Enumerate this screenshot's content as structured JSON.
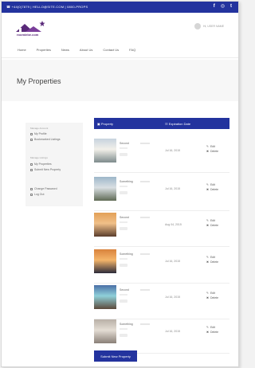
{
  "topbar": {
    "contact": "☎ +44(0)7879 | HELLO@SITE.COM | 0800-PROPS",
    "social": [
      "f",
      "◎",
      "t"
    ]
  },
  "brand": {
    "name": "roomiebe.com"
  },
  "user": {
    "name": "Hi, USER NAME"
  },
  "nav": {
    "items": [
      "Home",
      "Properties",
      "News",
      "About Us",
      "Contact Us",
      "FAQ"
    ]
  },
  "page": {
    "title": "My Properties"
  },
  "sidebar": {
    "groups": [
      {
        "heading": "Manage Account",
        "links": [
          "My Profile",
          "Bookmarked Listings"
        ]
      },
      {
        "heading": "Manage Listings",
        "links": [
          "My Properties",
          "Submit New Property"
        ]
      },
      {
        "heading": "",
        "links": [
          "Change Password",
          "Log Out"
        ]
      }
    ]
  },
  "table": {
    "col_property": "▣ Property",
    "col_expiration": "☷ Expiration Date",
    "edit_label": "Edit",
    "delete_label": "Delete",
    "rows": [
      {
        "name": "Second",
        "date": "Jul 16, 2015",
        "colors": [
          "#c7d3de",
          "#7d8b8c",
          "#f2f0ea"
        ]
      },
      {
        "name": "Something",
        "date": "Jul 16, 2015",
        "colors": [
          "#9db7c9",
          "#5f6a55",
          "#d9dfe3"
        ]
      },
      {
        "name": "Second",
        "date": "Aug 04, 2015",
        "colors": [
          "#e2a057",
          "#5a3d2c",
          "#f0c089"
        ]
      },
      {
        "name": "Something",
        "date": "Jul 16, 2015",
        "colors": [
          "#d9823c",
          "#2c2b3a",
          "#f4b56a"
        ]
      },
      {
        "name": "Second",
        "date": "Jul 16, 2015",
        "colors": [
          "#4a6fa6",
          "#5c4a3b",
          "#8fd0d9"
        ]
      },
      {
        "name": "Something",
        "date": "Jul 16, 2015",
        "colors": [
          "#b9b0a7",
          "#8a8078",
          "#e4ddd4"
        ]
      }
    ]
  },
  "submit": {
    "label": "Submit New Property"
  },
  "colors": {
    "accent": "#23339e",
    "brand": "#5a2a7a"
  }
}
